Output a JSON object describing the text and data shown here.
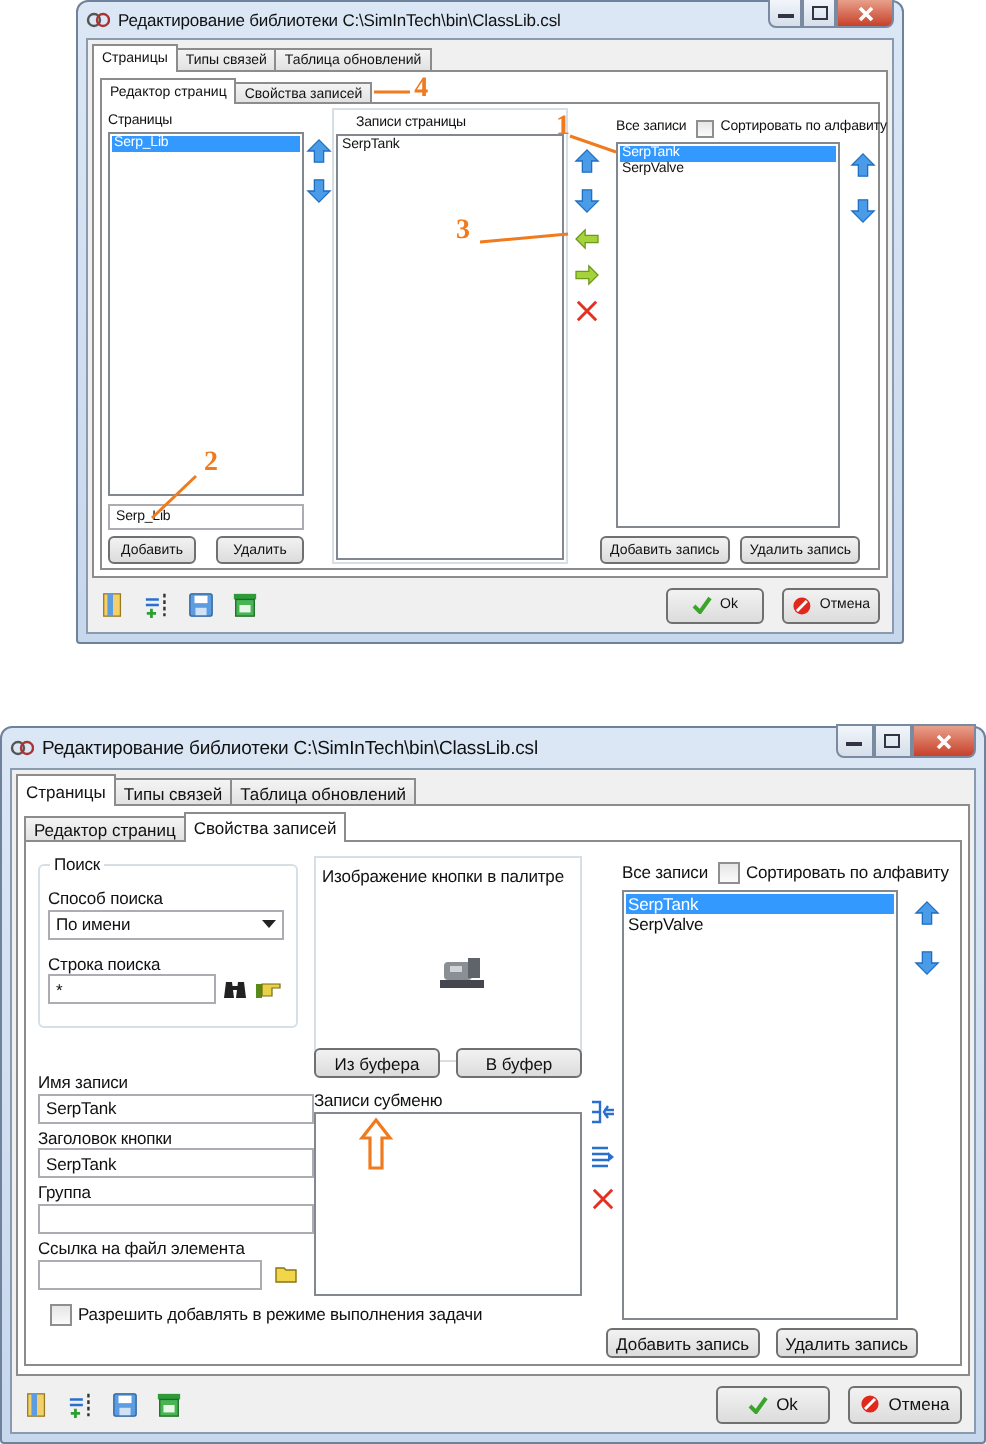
{
  "windows": [
    {
      "kind": "page_editor",
      "title": "Редактирование библиотеки  C:\\SimInTech\\bin\\ClassLib.csl",
      "tabs": [
        {
          "label": "Страницы",
          "selected": true
        },
        {
          "label": "Типы связей",
          "selected": false
        },
        {
          "label": "Таблица обновлений",
          "selected": false
        }
      ],
      "subtabs": [
        {
          "label": "Редактор страниц",
          "selected": true
        },
        {
          "label": "Свойства записей",
          "selected": false
        }
      ],
      "pages": {
        "label": "Страницы",
        "items": [
          {
            "label": "Serp_Lib",
            "selected": true
          }
        ],
        "name_value": "Serp_Lib",
        "buttons": [
          "Добавить",
          "Удалить"
        ]
      },
      "page_records": {
        "label": "Записи страницы",
        "items": [
          {
            "label": "SerpTank",
            "selected": false
          }
        ]
      },
      "all_records": {
        "label": "Все записи",
        "sort": {
          "label": "Сортировать по алфавиту",
          "checked": false
        },
        "items": [
          {
            "label": "SerpTank",
            "selected": true
          },
          {
            "label": "SerpValve",
            "selected": false
          }
        ],
        "buttons": [
          "Добавить запись",
          "Удалить запись"
        ]
      },
      "footer_buttons": [
        "Ok",
        "Отмена"
      ],
      "callouts": [
        {
          "label": "1"
        },
        {
          "label": "2"
        },
        {
          "label": "3"
        },
        {
          "label": "4"
        }
      ]
    },
    {
      "kind": "record_properties",
      "title": "Редактирование библиотеки  C:\\SimInTech\\bin\\ClassLib.csl",
      "tabs": [
        {
          "label": "Страницы",
          "selected": true
        },
        {
          "label": "Типы связей",
          "selected": false
        },
        {
          "label": "Таблица обновлений",
          "selected": false
        }
      ],
      "subtabs": [
        {
          "label": "Редактор страниц",
          "selected": false
        },
        {
          "label": "Свойства записей",
          "selected": true
        }
      ],
      "search": {
        "title": "Поиск",
        "method_label": "Способ поиска",
        "method_value": "По имени",
        "string_label": "Строка поиска",
        "string_value": "*"
      },
      "fields": [
        {
          "label": "Имя записи",
          "value": "SerpTank"
        },
        {
          "label": "Заголовок кнопки",
          "value": "SerpTank"
        },
        {
          "label": "Группа"
        },
        {
          "label": "Ссылка на файл элемента",
          "kind": "file"
        }
      ],
      "run_mode": {
        "label": "Разрешить добавлять в режиме выполнения задачи",
        "checked": false
      },
      "image_panel": {
        "label": "Изображение кнопки в палитре",
        "buttons": [
          "Из буфера",
          "В буфер"
        ]
      },
      "submenu": {
        "label": "Записи субменю"
      },
      "all_records": {
        "label": "Все записи",
        "sort": {
          "label": "Сортировать по алфавиту",
          "checked": false
        },
        "items": [
          {
            "label": "SerpTank",
            "selected": true
          },
          {
            "label": "SerpValve",
            "selected": false
          }
        ],
        "buttons": [
          "Добавить запись",
          "Удалить запись"
        ]
      },
      "footer_buttons": [
        "Ok",
        "Отмена"
      ]
    }
  ]
}
